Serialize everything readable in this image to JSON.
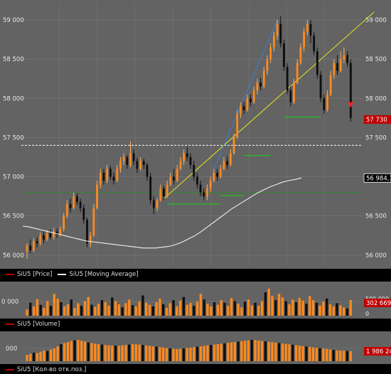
{
  "colors": {
    "background": "#636363",
    "panel_bg": "#000000",
    "grid": "#777777",
    "candle_up": "#ff8a1e",
    "candle_down": "#0d0d0d",
    "moving_average": "#f0f0f0",
    "trendline": "#e6e61e",
    "level_line": "#21c021",
    "horizontal_dotted": "#ffffff",
    "baseline_green": "#2a8a2a",
    "price_tag": "#c00000",
    "volume_up": "#ff8a1e",
    "volume_down": "#0d0d0d",
    "blue_line": "#3a7fd5"
  },
  "price_panel": {
    "legend": [
      {
        "label": "SiU5 [Price]",
        "color": "#c00000"
      },
      {
        "label": "SiU5 [Moving Average]",
        "color": "#ffffff"
      }
    ],
    "y_ticks_left": [
      "59 000",
      "58 500",
      "58 000",
      "57 500",
      "57 000",
      "56 500",
      "56 000"
    ],
    "y_ticks_right": [
      "59 000",
      "58 500",
      "58 000",
      "57 500",
      "57 000",
      "56 500",
      "56 000"
    ],
    "last_price_tag": "57 730",
    "ma_tag": "56 984,1"
  },
  "volume_panel": {
    "legend": [
      {
        "label": "SiU5 [Volume]",
        "color": "#c00000"
      }
    ],
    "y_ticks_left": [
      "0 000"
    ],
    "y_ticks_right": [
      "500 000",
      "0"
    ],
    "value_tag": "302 669"
  },
  "oi_panel": {
    "legend": [
      {
        "label": "SiU5 [Кол-во отк.поз.]",
        "color": "#c00000"
      }
    ],
    "y_ticks_left": [
      "000"
    ],
    "value_tag": "1 986 24"
  },
  "chart_data": [
    {
      "type": "candlestick",
      "title": "",
      "ylim": [
        55880,
        59200
      ],
      "series": [
        {
          "name": "SiU5 [Price]",
          "candles": [
            [
              56050,
              56120,
              55950,
              56150
            ],
            [
              56120,
              56060,
              56020,
              56200
            ],
            [
              56060,
              56180,
              56040,
              56220
            ],
            [
              56180,
              56150,
              56100,
              56230
            ],
            [
              56150,
              56250,
              56120,
              56290
            ],
            [
              56250,
              56200,
              56150,
              56300
            ],
            [
              56200,
              56280,
              56180,
              56320
            ],
            [
              56280,
              56230,
              56200,
              56330
            ],
            [
              56230,
              56300,
              56200,
              56350
            ],
            [
              56300,
              56260,
              56220,
              56340
            ],
            [
              56260,
              56330,
              56240,
              56370
            ],
            [
              56330,
              56500,
              56300,
              56540
            ],
            [
              56500,
              56650,
              56470,
              56700
            ],
            [
              56650,
              56600,
              56540,
              56720
            ],
            [
              56600,
              56750,
              56580,
              56800
            ],
            [
              56750,
              56680,
              56640,
              56790
            ],
            [
              56680,
              56600,
              56550,
              56720
            ],
            [
              56600,
              56450,
              56400,
              56650
            ],
            [
              56450,
              56150,
              56100,
              56480
            ],
            [
              56150,
              56250,
              56100,
              56300
            ],
            [
              56250,
              56600,
              56230,
              56650
            ],
            [
              56600,
              56900,
              56580,
              56950
            ],
            [
              56900,
              57050,
              56850,
              57100
            ],
            [
              57050,
              56950,
              56900,
              57100
            ],
            [
              56950,
              57100,
              56920,
              57150
            ],
            [
              57100,
              57000,
              56960,
              57140
            ],
            [
              57000,
              56950,
              56900,
              57050
            ],
            [
              56950,
              57100,
              56930,
              57150
            ],
            [
              57100,
              57200,
              57050,
              57250
            ],
            [
              57200,
              57250,
              57150,
              57300
            ],
            [
              57250,
              57150,
              57100,
              57280
            ],
            [
              57150,
              57300,
              57120,
              57450
            ],
            [
              57300,
              57200,
              57150,
              57350
            ],
            [
              57200,
              57100,
              57050,
              57240
            ],
            [
              57100,
              57200,
              57080,
              57250
            ],
            [
              57200,
              57150,
              57100,
              57230
            ],
            [
              57150,
              57000,
              56950,
              57180
            ],
            [
              57000,
              56700,
              56650,
              57050
            ],
            [
              56700,
              56600,
              56520,
              56750
            ],
            [
              56600,
              56700,
              56560,
              56730
            ],
            [
              56700,
              56850,
              56680,
              56900
            ],
            [
              56850,
              56750,
              56700,
              56880
            ],
            [
              56750,
              56900,
              56730,
              56950
            ],
            [
              56900,
              57000,
              56880,
              57050
            ],
            [
              57000,
              56950,
              56900,
              57100
            ],
            [
              56950,
              57100,
              56930,
              57150
            ],
            [
              57100,
              57200,
              57080,
              57250
            ],
            [
              57200,
              57300,
              57150,
              57350
            ],
            [
              57300,
              57250,
              57200,
              57380
            ],
            [
              57250,
              57150,
              57100,
              57300
            ],
            [
              57150,
              57000,
              56950,
              57200
            ],
            [
              57000,
              56900,
              56850,
              57050
            ],
            [
              56900,
              56800,
              56750,
              56950
            ],
            [
              56800,
              56750,
              56700,
              56850
            ],
            [
              56750,
              56850,
              56700,
              56900
            ],
            [
              56850,
              56950,
              56800,
              57000
            ],
            [
              56950,
              57050,
              56930,
              57100
            ],
            [
              57050,
              57000,
              56950,
              57100
            ],
            [
              57000,
              57100,
              56980,
              57150
            ],
            [
              57100,
              57200,
              57080,
              57250
            ],
            [
              57200,
              57150,
              57100,
              57260
            ],
            [
              57150,
              57300,
              57130,
              57350
            ],
            [
              57300,
              57500,
              57280,
              57550
            ],
            [
              57500,
              57800,
              57480,
              57850
            ],
            [
              57800,
              57900,
              57750,
              57950
            ],
            [
              57900,
              57850,
              57800,
              57950
            ],
            [
              57850,
              58000,
              57830,
              58050
            ],
            [
              58000,
              57950,
              57900,
              58050
            ],
            [
              57950,
              58100,
              57930,
              58150
            ],
            [
              58100,
              58200,
              58050,
              58250
            ],
            [
              58200,
              58150,
              58100,
              58260
            ],
            [
              58150,
              58350,
              58130,
              58400
            ],
            [
              58350,
              58500,
              58300,
              58550
            ],
            [
              58500,
              58650,
              58450,
              58700
            ],
            [
              58650,
              58800,
              58600,
              58850
            ],
            [
              58800,
              58950,
              58750,
              59000
            ],
            [
              58950,
              58700,
              58650,
              59050
            ],
            [
              58700,
              58400,
              58350,
              58750
            ],
            [
              58400,
              58100,
              58050,
              58450
            ],
            [
              58100,
              57950,
              57900,
              58150
            ],
            [
              57950,
              58200,
              57930,
              58250
            ],
            [
              58200,
              58450,
              58180,
              58500
            ],
            [
              58450,
              58650,
              58430,
              58700
            ],
            [
              58650,
              58850,
              58600,
              58900
            ],
            [
              58850,
              58950,
              58800,
              59000
            ],
            [
              58950,
              58800,
              58700,
              59000
            ],
            [
              58800,
              58600,
              58550,
              58850
            ],
            [
              58600,
              58300,
              58250,
              58650
            ],
            [
              58300,
              58000,
              57950,
              58350
            ],
            [
              58000,
              57850,
              57800,
              58050
            ],
            [
              57850,
              58050,
              57830,
              58100
            ],
            [
              58050,
              58300,
              58030,
              58350
            ],
            [
              58300,
              58450,
              58250,
              58500
            ],
            [
              58450,
              58350,
              58300,
              58550
            ],
            [
              58350,
              58500,
              58330,
              58600
            ],
            [
              58500,
              58550,
              58450,
              58650
            ],
            [
              58550,
              58450,
              58400,
              58600
            ],
            [
              58450,
              57750,
              57700,
              58500
            ]
          ]
        },
        {
          "name": "SiU5 [Moving Average]",
          "values": [
            56370,
            56360,
            56340,
            56320,
            56300,
            56280,
            56260,
            56240,
            56220,
            56200,
            56180,
            56170,
            56160,
            56150,
            56140,
            56130,
            56120,
            56110,
            56100,
            56090,
            56090,
            56090,
            56100,
            56110,
            56130,
            56160,
            56200,
            56240,
            56290,
            56350,
            56410,
            56470,
            56530,
            56590,
            56640,
            56690,
            56740,
            56790,
            56830,
            56870,
            56900,
            56930,
            56950,
            56965,
            56984
          ]
        }
      ]
    },
    {
      "type": "bar",
      "title": "",
      "series": [
        {
          "name": "SiU5 [Volume]",
          "values": [
            120,
            250,
            180,
            320,
            210,
            150,
            280,
            190,
            420,
            330,
            260,
            180,
            220,
            310,
            150,
            240,
            190,
            280,
            360,
            210,
            170,
            230,
            300,
            260,
            190,
            350,
            280,
            220,
            160,
            240,
            310,
            200,
            180,
            270,
            390,
            250,
            210,
            180,
            260,
            330,
            220,
            150,
            240,
            300,
            180,
            290,
            360,
            210,
            250,
            190,
            270,
            420,
            310,
            230,
            180,
            260,
            210,
            300,
            250,
            190,
            340,
            280,
            230,
            160,
            270,
            310,
            200,
            250,
            190,
            280,
            450,
            520,
            380,
            300,
            420,
            350,
            280,
            220,
            310,
            260,
            340,
            290,
            230,
            380,
            300,
            250,
            190,
            270,
            330,
            220,
            180,
            240,
            200,
            160,
            140,
            302
          ]
        }
      ]
    },
    {
      "type": "bar",
      "title": "",
      "series": [
        {
          "name": "SiU5 [Кол-во отк.поз.]",
          "values": [
            30,
            35,
            40,
            38,
            45,
            50,
            48,
            55,
            60,
            70,
            80,
            85,
            90,
            95,
            98,
            100,
            96,
            92,
            88,
            85,
            82,
            80,
            78,
            76,
            75,
            74,
            73,
            72,
            74,
            76,
            78,
            80,
            79,
            78,
            76,
            74,
            72,
            70,
            68,
            66,
            64,
            62,
            60,
            58,
            56,
            58,
            60,
            62,
            64,
            66,
            68,
            70,
            72,
            74,
            76,
            78,
            80,
            82,
            84,
            86,
            88,
            90,
            92,
            94,
            96,
            98,
            100,
            99,
            97,
            95,
            93,
            91,
            89,
            87,
            85,
            83,
            81,
            79,
            77,
            75,
            73,
            71,
            69,
            67,
            65,
            63,
            61,
            59,
            57,
            55,
            53,
            51,
            50,
            49,
            48,
            47
          ]
        }
      ]
    }
  ]
}
